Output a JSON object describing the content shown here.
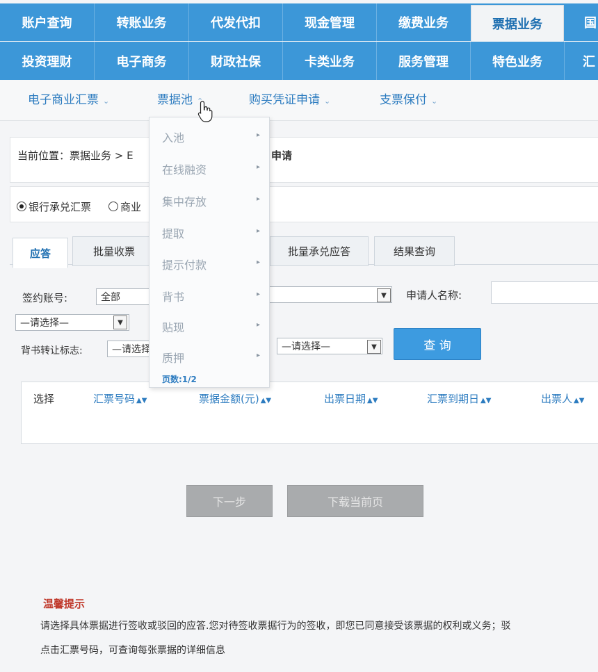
{
  "top_nav_row1": [
    {
      "label": "账户查询"
    },
    {
      "label": "转账业务"
    },
    {
      "label": "代发代扣"
    },
    {
      "label": "现金管理"
    },
    {
      "label": "缴费业务"
    },
    {
      "label": "票据业务"
    },
    {
      "label": "国"
    }
  ],
  "top_nav_row2": [
    {
      "label": "投资理财"
    },
    {
      "label": "电子商务"
    },
    {
      "label": "财政社保"
    },
    {
      "label": "卡类业务"
    },
    {
      "label": "服务管理"
    },
    {
      "label": "特色业务"
    },
    {
      "label": "汇"
    }
  ],
  "sub_nav": [
    {
      "label": "电子商业汇票"
    },
    {
      "label": "票据池"
    },
    {
      "label": "购买凭证申请"
    },
    {
      "label": "支票保付"
    }
  ],
  "breadcrumb": {
    "prefix": "当前位置：票据业务 > E",
    "tail": "申请"
  },
  "bill_type": {
    "option1": "银行承兑汇票",
    "option2": "商业"
  },
  "tabs": [
    {
      "label": "应答"
    },
    {
      "label": "批量收票"
    },
    {
      "label": "批量承兑应答"
    },
    {
      "label": "结果查询"
    }
  ],
  "form": {
    "sign_account_label": "签约账号:",
    "sign_account_value": "全部",
    "please_select_1": "—请选择—",
    "applicant_name_label": "申请人名称:",
    "endorse_flag_label": "背书转让标志:",
    "please_select_2": "—请选择",
    "please_select_3": "—请选择—",
    "query_button": "查 询"
  },
  "table": {
    "headers": [
      "选择",
      "汇票号码",
      "票据金额(元)",
      "出票日期",
      "汇票到期日",
      "出票人"
    ]
  },
  "buttons": {
    "next": "下一步",
    "download": "下载当前页"
  },
  "tips": {
    "title": "温馨提示",
    "line1": "请选择具体票据进行签收或驳回的应答.您对待签收票据行为的签收，即您已同意接受该票据的权利或义务；驳",
    "line2": "点击汇票号码，可查询每张票据的详细信息"
  },
  "dropdown": {
    "items": [
      {
        "label": "入池"
      },
      {
        "label": "在线融资"
      },
      {
        "label": "集中存放"
      },
      {
        "label": "提取"
      },
      {
        "label": "提示付款"
      },
      {
        "label": "背书"
      },
      {
        "label": "贴现"
      },
      {
        "label": "质押"
      }
    ],
    "pages": "页数:1/2"
  },
  "colors": {
    "nav_blue": "#3c97d8",
    "link_blue": "#2d7cc0",
    "tip_red": "#c0392b"
  }
}
